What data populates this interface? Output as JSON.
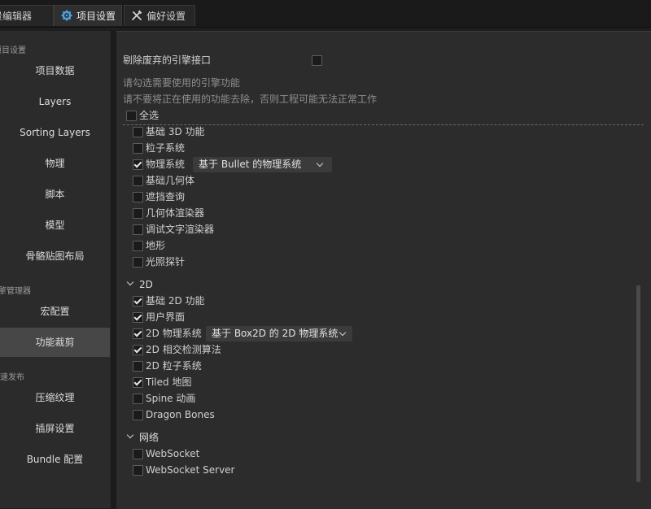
{
  "tabs": [
    {
      "label": "场景编辑器",
      "icon": "none"
    },
    {
      "label": "项目设置",
      "icon": "gear-icon"
    },
    {
      "label": "偏好设置",
      "icon": "tools-icon"
    }
  ],
  "sidebar": {
    "group1": "项目设置",
    "items1": [
      "项目数据",
      "Layers",
      "Sorting Layers",
      "物理",
      "脚本",
      "模型",
      "骨骼贴图布局"
    ],
    "group2": "引擎管理器",
    "items2": [
      "宏配置",
      "功能裁剪"
    ],
    "group3": "快速发布",
    "items3": [
      "压缩纹理",
      "插屏设置",
      "Bundle 配置"
    ],
    "active": "功能裁剪"
  },
  "main": {
    "deprecated_label": "剔除废弃的引擎接口",
    "hint1": "请勾选需要使用的引擎功能",
    "hint2": "请不要将正在使用的功能去除，否则工程可能无法正常工作",
    "select_all": "全选",
    "features3d": [
      {
        "label": "基础 3D 功能",
        "checked": false
      },
      {
        "label": "粒子系统",
        "checked": false
      },
      {
        "label": "物理系统",
        "checked": true,
        "select": "基于 Bullet 的物理系统"
      },
      {
        "label": "基础几何体",
        "checked": false
      },
      {
        "label": "遮挡查询",
        "checked": false
      },
      {
        "label": "几何体渲染器",
        "checked": false
      },
      {
        "label": "调试文字渲染器",
        "checked": false
      },
      {
        "label": "地形",
        "checked": false
      },
      {
        "label": "光照探针",
        "checked": false
      }
    ],
    "section2d": "2D",
    "features2d": [
      {
        "label": "基础 2D 功能",
        "checked": true
      },
      {
        "label": "用户界面",
        "checked": true
      },
      {
        "label": "2D 物理系统",
        "checked": true,
        "select": "基于 Box2D 的 2D 物理系统"
      },
      {
        "label": "2D 相交检测算法",
        "checked": true
      },
      {
        "label": "2D 粒子系统",
        "checked": false
      },
      {
        "label": "Tiled 地图",
        "checked": true
      },
      {
        "label": "Spine 动画",
        "checked": false
      },
      {
        "label": "Dragon Bones",
        "checked": false
      }
    ],
    "section_net": "网络",
    "features_net": [
      {
        "label": "WebSocket",
        "checked": false
      },
      {
        "label": "WebSocket Server",
        "checked": false
      }
    ]
  }
}
